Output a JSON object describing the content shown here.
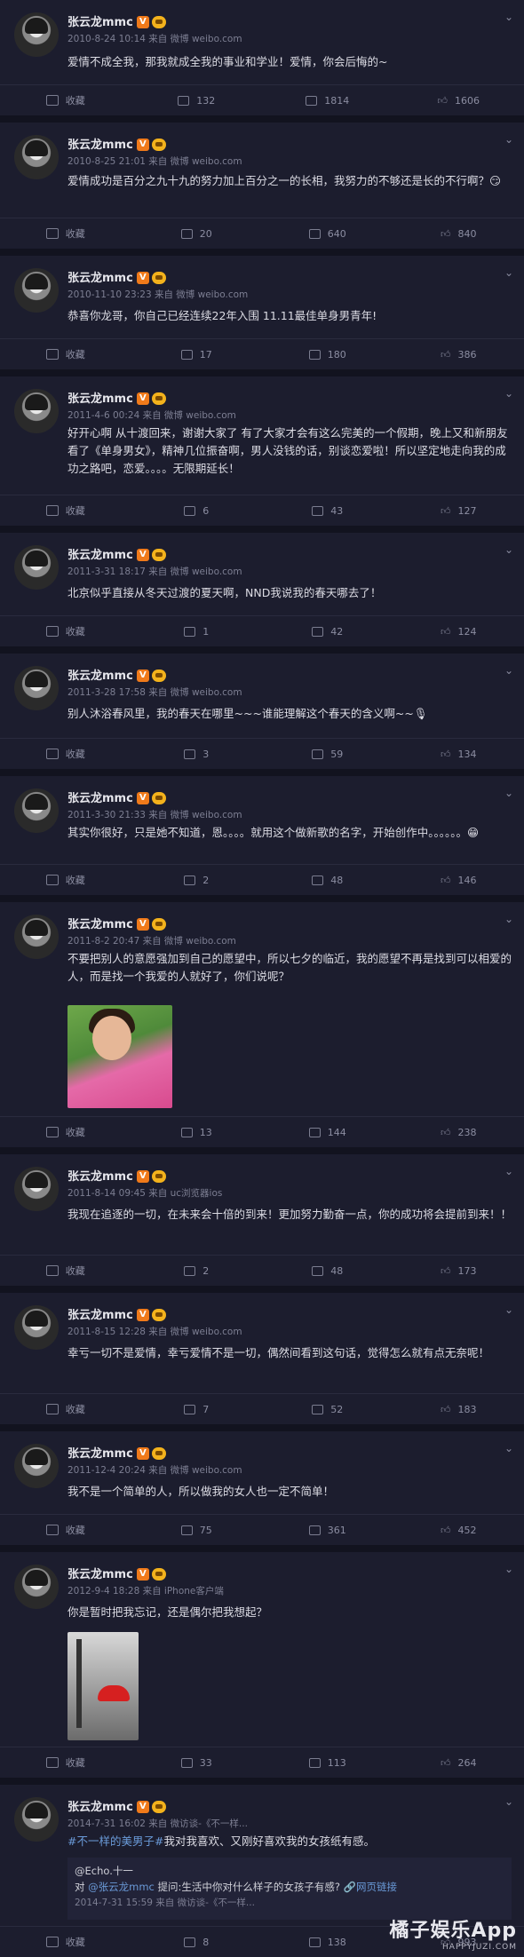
{
  "user": {
    "name": "张云龙mmc",
    "verified_badge": "V"
  },
  "action_labels": {
    "fav": "收藏"
  },
  "posts": [
    {
      "time": "2010-8-24 10:14 来自 微博 weibo.com",
      "text": "爱情不成全我，那我就成全我的事业和学业！爱情，你会后悔的~",
      "comments": "132",
      "reposts": "1814",
      "likes": "1606"
    },
    {
      "time": "2010-8-25 21:01 来自 微博 weibo.com",
      "text": "爱情成功是百分之九十九的努力加上百分之一的长相，我努力的不够还是长的不行啊？😏",
      "comments": "20",
      "reposts": "640",
      "likes": "840"
    },
    {
      "time": "2010-11-10 23:23 来自 微博 weibo.com",
      "text": "恭喜你龙哥，你自己已经连续22年入围 11.11最佳单身男青年!",
      "comments": "17",
      "reposts": "180",
      "likes": "386"
    },
    {
      "time": "2011-4-6 00:24 来自 微博 weibo.com",
      "text": "好开心啊 从十渡回来，谢谢大家了 有了大家才会有这么完美的一个假期，晚上又和新朋友看了《单身男女》，精神几位振奋啊，男人没钱的话，别谈恋爱啦！所以坚定地走向我的成功之路吧，恋爱。。。。无限期延长！",
      "comments": "6",
      "reposts": "43",
      "likes": "127"
    },
    {
      "time": "2011-3-31 18:17 来自 微博 weibo.com",
      "text": "北京似乎直接从冬天过渡的夏天啊，NND我说我的春天哪去了！",
      "comments": "1",
      "reposts": "42",
      "likes": "124"
    },
    {
      "time": "2011-3-28 17:58 来自 微博 weibo.com",
      "text": "别人沐浴春风里，我的春天在哪里~~~谁能理解这个春天的含义啊~~🎙",
      "comments": "3",
      "reposts": "59",
      "likes": "134"
    },
    {
      "time": "2011-3-30 21:33 来自 微博 weibo.com",
      "text": "其实你很好，只是她不知道，恩。。。。就用这个做新歌的名字，开始创作中。。。。。。😁",
      "comments": "2",
      "reposts": "48",
      "likes": "146"
    },
    {
      "time": "2011-8-2 20:47 来自 微博 weibo.com",
      "text": "不要把别人的意愿强加到自己的愿望中，所以七夕的临近，我的愿望不再是找到可以相爱的人，而是找一个我爱的人就好了，你们说呢？",
      "comments": "13",
      "reposts": "144",
      "likes": "238"
    },
    {
      "time": "2011-8-14 09:45 来自 uc浏览器ios",
      "text": "我现在追逐的一切，在未来会十倍的到来！更加努力勤奋一点，你的成功将会提前到来！！",
      "comments": "2",
      "reposts": "48",
      "likes": "173"
    },
    {
      "time": "2011-8-15 12:28 来自 微博 weibo.com",
      "text": "幸亏一切不是爱情，幸亏爱情不是一切，偶然间看到这句话，觉得怎么就有点无奈呢！",
      "comments": "7",
      "reposts": "52",
      "likes": "183"
    },
    {
      "time": "2011-12-4 20:24 来自 微博 weibo.com",
      "text": "我不是一个简单的人，所以做我的女人也一定不简单！",
      "comments": "75",
      "reposts": "361",
      "likes": "452"
    },
    {
      "time": "2012-9-4 18:28 来自 iPhone客户端",
      "text": "你是暂时把我忘记，还是偶尔把我想起？",
      "comments": "33",
      "reposts": "113",
      "likes": "264"
    },
    {
      "time": "2014-7-31 16:02 来自 微访谈-《不一样...",
      "text_link": "#不一样的美男子#",
      "text_rest": "我对我喜欢、又刚好喜欢我的女孩纸有感。",
      "comments": "8",
      "reposts": "138",
      "likes": "993"
    }
  ],
  "repost_box": {
    "author": "@Echo.十一",
    "line_prefix": "对 ",
    "mention": "@张云龙mmc",
    "line_rest": " 提问:生活中你对什么样子的女孩子有感?",
    "link": "🔗网页链接",
    "time": "2014-7-31 15:59 来自 微访谈-《不一样..."
  },
  "watermark": {
    "title": "橘子娱乐App",
    "sub": "HAPPYJUZI.COM"
  }
}
